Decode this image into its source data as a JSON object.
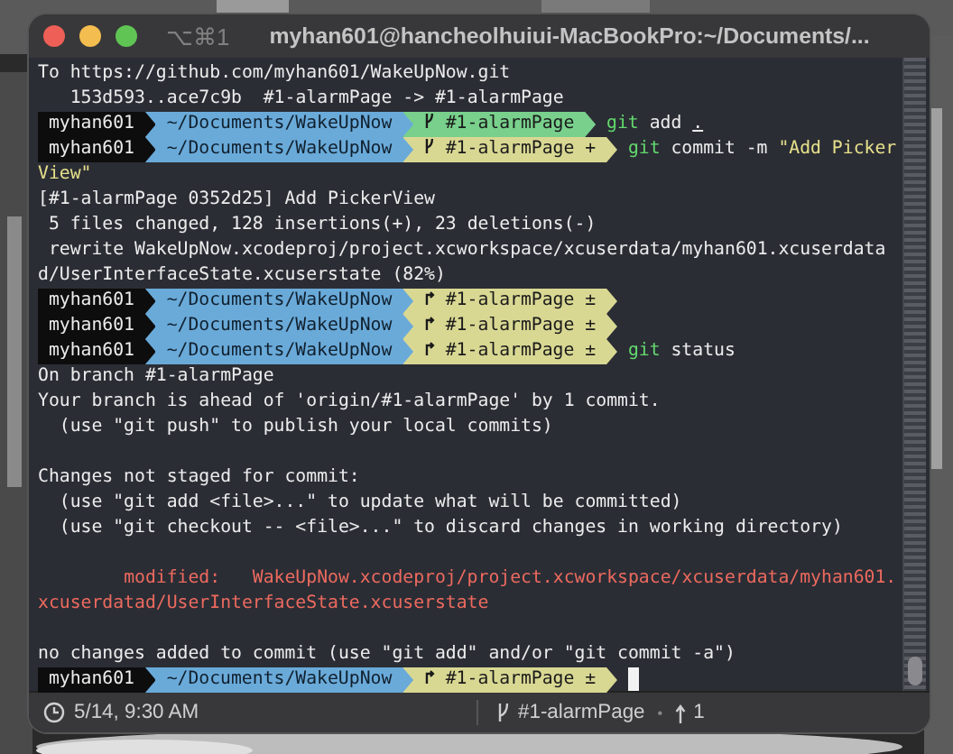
{
  "window": {
    "shortcut": "⌥⌘1",
    "title": "myhan601@hancheolhuiui-MacBookPro:~/Documents/..."
  },
  "terminal": {
    "lines": [
      {
        "kind": "output",
        "text": "To https://github.com/myhan601/WakeUpNow.git"
      },
      {
        "kind": "output",
        "text": "   153d593..ace7c9b  #1-alarmPage -> #1-alarmPage"
      },
      {
        "kind": "prompt",
        "user": "myhan601",
        "path": "~/Documents/WakeUpNow",
        "branch": {
          "kind": "clean",
          "name": "#1-alarmPage"
        },
        "command": [
          {
            "kind": "program",
            "text": "git"
          },
          {
            "kind": "plain",
            "text": "add"
          },
          {
            "kind": "path",
            "text": "."
          }
        ]
      },
      {
        "kind": "prompt",
        "user": "myhan601",
        "path": "~/Documents/WakeUpNow",
        "branch": {
          "kind": "staged",
          "name": "#1-alarmPage",
          "status_symbol": "+"
        },
        "command": [
          {
            "kind": "program",
            "text": "git"
          },
          {
            "kind": "plain",
            "text": "commit -m"
          },
          {
            "kind": "string",
            "text": "\"Add Picker"
          }
        ]
      },
      {
        "kind": "string",
        "text": "View\""
      },
      {
        "kind": "output",
        "text": "[#1-alarmPage 0352d25] Add PickerView"
      },
      {
        "kind": "output",
        "text": " 5 files changed, 128 insertions(+), 23 deletions(-)"
      },
      {
        "kind": "output",
        "text": " rewrite WakeUpNow.xcodeproj/project.xcworkspace/xcuserdata/myhan601.xcuserdatad/UserInterfaceState.xcuserstate (82%)"
      },
      {
        "kind": "prompt",
        "user": "myhan601",
        "path": "~/Documents/WakeUpNow",
        "branch": {
          "kind": "dirty",
          "name": "#1-alarmPage",
          "status_symbol": "±"
        }
      },
      {
        "kind": "prompt",
        "user": "myhan601",
        "path": "~/Documents/WakeUpNow",
        "branch": {
          "kind": "dirty",
          "name": "#1-alarmPage",
          "status_symbol": "±"
        }
      },
      {
        "kind": "prompt",
        "user": "myhan601",
        "path": "~/Documents/WakeUpNow",
        "branch": {
          "kind": "dirty",
          "name": "#1-alarmPage",
          "status_symbol": "±"
        },
        "command": [
          {
            "kind": "program",
            "text": "git"
          },
          {
            "kind": "plain",
            "text": "status"
          }
        ]
      },
      {
        "kind": "output",
        "text": "On branch #1-alarmPage"
      },
      {
        "kind": "output",
        "text": "Your branch is ahead of 'origin/#1-alarmPage' by 1 commit."
      },
      {
        "kind": "output",
        "text": "  (use \"git push\" to publish your local commits)"
      },
      {
        "kind": "blank"
      },
      {
        "kind": "output",
        "text": "Changes not staged for commit:"
      },
      {
        "kind": "output",
        "text": "  (use \"git add <file>...\" to update what will be committed)"
      },
      {
        "kind": "output",
        "text": "  (use \"git checkout -- <file>...\" to discard changes in working directory)"
      },
      {
        "kind": "blank"
      },
      {
        "kind": "error",
        "text": "        modified:   WakeUpNow.xcodeproj/project.xcworkspace/xcuserdata/myhan601.xcuserdatad/UserInterfaceState.xcuserstate"
      },
      {
        "kind": "blank"
      },
      {
        "kind": "output",
        "text": "no changes added to commit (use \"git add\" and/or \"git commit -a\")"
      },
      {
        "kind": "prompt",
        "user": "myhan601",
        "path": "~/Documents/WakeUpNow",
        "branch": {
          "kind": "dirty",
          "name": "#1-alarmPage",
          "status_symbol": "±"
        },
        "cursor": true
      }
    ]
  },
  "status_bar": {
    "time": "5/14, 9:30 AM",
    "branch": "#1-alarmPage",
    "separator": "•",
    "ahead": "1"
  }
}
